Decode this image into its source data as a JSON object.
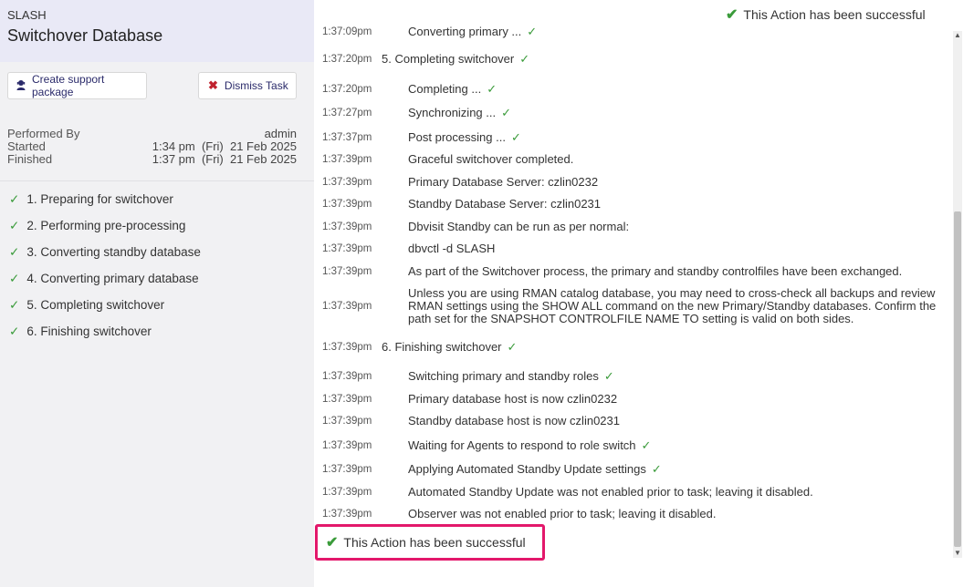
{
  "header": {
    "db_name": "SLASH",
    "title": "Switchover Database"
  },
  "buttons": {
    "support": "Create support package",
    "dismiss": "Dismiss Task"
  },
  "meta": {
    "performed_by_label": "Performed By",
    "performed_by": "admin",
    "started_label": "Started",
    "started": "1:34 pm  (Fri)  21 Feb 2025",
    "finished_label": "Finished",
    "finished": "1:37 pm  (Fri)  21 Feb 2025"
  },
  "steps": [
    "1. Preparing for switchover",
    "2. Performing pre-processing",
    "3. Converting standby database",
    "4. Converting primary database",
    "5. Completing switchover",
    "6. Finishing switchover"
  ],
  "success_text": "This Action has been successful",
  "log": [
    {
      "time": "1:37:09pm",
      "msg": "Converting primary ...",
      "ok": true,
      "phase": false
    },
    {
      "time": "1:37:20pm",
      "msg": "5. Completing switchover",
      "ok": true,
      "phase": true
    },
    {
      "time": "1:37:20pm",
      "msg": "Completing ...",
      "ok": true,
      "phase": false
    },
    {
      "time": "1:37:27pm",
      "msg": "Synchronizing ...",
      "ok": true,
      "phase": false
    },
    {
      "time": "1:37:37pm",
      "msg": "Post processing ...",
      "ok": true,
      "phase": false
    },
    {
      "time": "1:37:39pm",
      "msg": "Graceful switchover completed.",
      "ok": false,
      "phase": false
    },
    {
      "time": "1:37:39pm",
      "msg": "Primary Database Server: czlin0232",
      "ok": false,
      "phase": false
    },
    {
      "time": "1:37:39pm",
      "msg": "Standby Database Server: czlin0231",
      "ok": false,
      "phase": false
    },
    {
      "time": "1:37:39pm",
      "msg": "Dbvisit Standby can be run as per normal:",
      "ok": false,
      "phase": false
    },
    {
      "time": "1:37:39pm",
      "msg": "dbvctl -d SLASH",
      "ok": false,
      "phase": false
    },
    {
      "time": "1:37:39pm",
      "msg": "As part of the Switchover process, the primary and standby controlfiles have been exchanged.",
      "ok": false,
      "phase": false
    },
    {
      "time": "1:37:39pm",
      "msg": "Unless you are using RMAN catalog database, you may need to cross-check all backups and review RMAN settings using the SHOW ALL command on the new Primary/Standby databases. Confirm the path set for the SNAPSHOT CONTROLFILE NAME TO setting is valid on both sides.",
      "ok": false,
      "phase": false
    },
    {
      "time": "1:37:39pm",
      "msg": "6. Finishing switchover",
      "ok": true,
      "phase": true
    },
    {
      "time": "1:37:39pm",
      "msg": "Switching primary and standby roles",
      "ok": true,
      "phase": false
    },
    {
      "time": "1:37:39pm",
      "msg": "Primary database host is now czlin0232",
      "ok": false,
      "phase": false
    },
    {
      "time": "1:37:39pm",
      "msg": "Standby database host is now czlin0231",
      "ok": false,
      "phase": false
    },
    {
      "time": "1:37:39pm",
      "msg": "Waiting for Agents to respond to role switch",
      "ok": true,
      "phase": false
    },
    {
      "time": "1:37:39pm",
      "msg": "Applying Automated Standby Update settings",
      "ok": true,
      "phase": false
    },
    {
      "time": "1:37:39pm",
      "msg": "Automated Standby Update was not enabled prior to task; leaving it disabled.",
      "ok": false,
      "phase": false
    },
    {
      "time": "1:37:39pm",
      "msg": "Observer was not enabled prior to task; leaving it disabled.",
      "ok": false,
      "phase": false
    }
  ],
  "icons": {
    "check": "check-icon",
    "support": "support-agent-icon",
    "dismiss": "close-icon"
  },
  "colors": {
    "success": "#3a9b3a",
    "highlight_border": "#e3186b",
    "dismiss": "#c0222e"
  }
}
